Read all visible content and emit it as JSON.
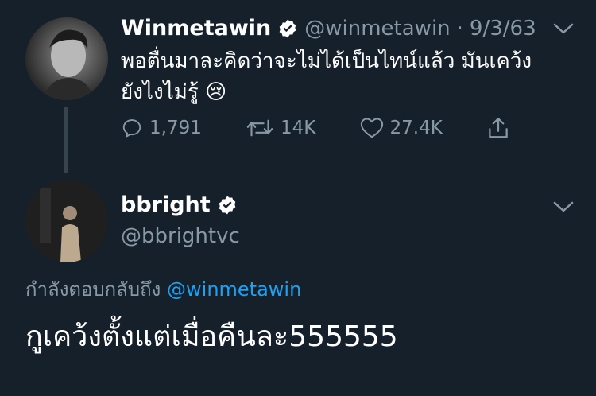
{
  "tweet1": {
    "name": "Winmetawin",
    "handle": "@winmetawin",
    "separator": "·",
    "date": "9/3/63",
    "text_line1": "พอตื่นมาละคิดว่าจะไม่ได้เป็นไทน์แล้ว มันเคว้ง",
    "text_line2": "ยังไงไม่รู้",
    "emoji": "😢",
    "actions": {
      "reply_count": "1,791",
      "retweet_count": "14K",
      "like_count": "27.4K"
    }
  },
  "tweet2": {
    "name": "bbright",
    "handle": "@bbrightvc",
    "replying_prefix": "กำลังตอบกลับถึง",
    "replying_to": "@winmetawin",
    "text": "กูเคว้งตั้งแต่เมื่อคืนละ555555"
  },
  "colors": {
    "background": "#15202b",
    "secondary_text": "#8899a6",
    "link": "#1da1f2",
    "thread_line": "#38444d"
  }
}
